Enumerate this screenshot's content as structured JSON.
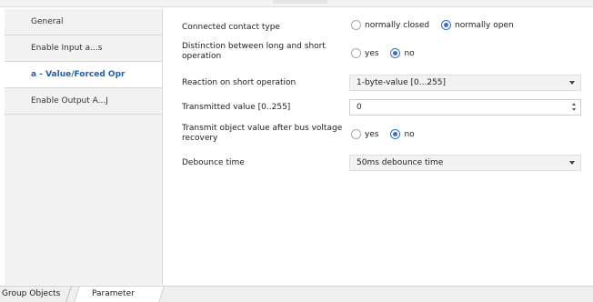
{
  "sidebar": {
    "items": [
      {
        "label": "General"
      },
      {
        "label": "Enable Input a...s"
      },
      {
        "label": "a - Value/Forced Opr"
      },
      {
        "label": "Enable Output A...J"
      }
    ]
  },
  "params": {
    "contact_type": {
      "label": "Connected contact type",
      "options": [
        "normally closed",
        "normally open"
      ],
      "selected": "normally open"
    },
    "long_short": {
      "label_line1": "Distinction between long and short",
      "label_line2": "operation",
      "options": [
        "yes",
        "no"
      ],
      "selected": "no"
    },
    "reaction_short": {
      "label": "Reaction on short operation",
      "value": "1-byte-value [0...255]"
    },
    "transmitted_value": {
      "label": "Transmitted value [0..255]",
      "value": "0"
    },
    "transmit_after_recovery": {
      "label_line1": "Transmit object value after bus voltage",
      "label_line2": "recovery",
      "options": [
        "yes",
        "no"
      ],
      "selected": "no"
    },
    "debounce": {
      "label": "Debounce time",
      "value": "50ms debounce time"
    }
  },
  "tabs": {
    "group_objects": "Group Objects",
    "parameter": "Parameter"
  },
  "colors": {
    "accent": "#3b6fc7",
    "active_sidebar_text": "#1f5fb0"
  }
}
